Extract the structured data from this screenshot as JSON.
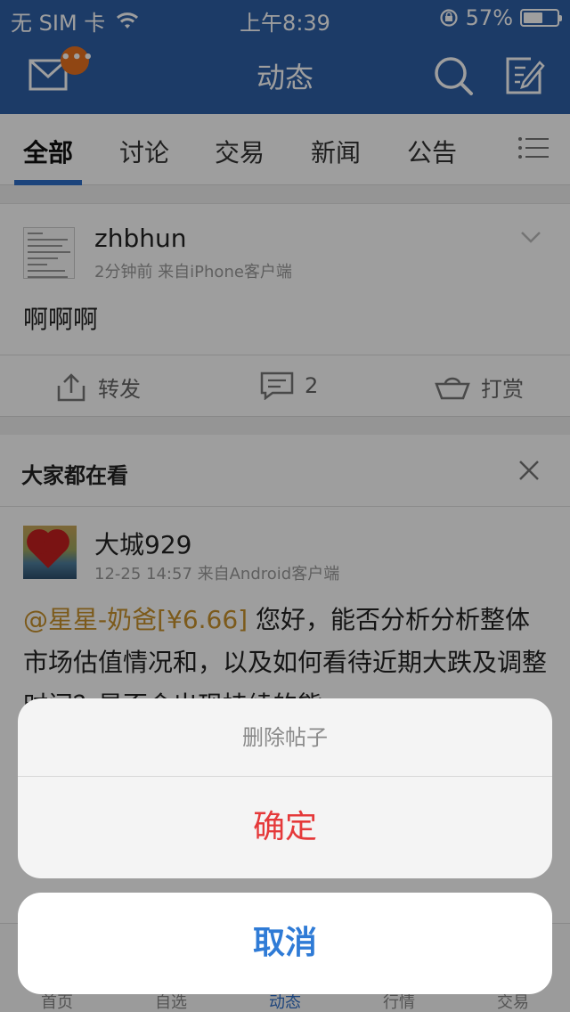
{
  "status_bar": {
    "carrier": "无 SIM 卡",
    "time": "上午8:39",
    "battery": "57%",
    "battery_level": 0.57
  },
  "navbar": {
    "title": "动态",
    "badge": "•••"
  },
  "tabs": [
    {
      "label": "全部",
      "active": true
    },
    {
      "label": "讨论"
    },
    {
      "label": "交易"
    },
    {
      "label": "新闻"
    },
    {
      "label": "公告"
    }
  ],
  "post": {
    "username": "zhbhun",
    "meta": "2分钟前  来自iPhone客户端",
    "content": "啊啊啊",
    "actions": {
      "forward": "转发",
      "comment_count": "2",
      "tip": "打赏"
    }
  },
  "recommend": {
    "heading": "大家都在看",
    "username": "大城929",
    "meta": "12-25 14:57  来自Android客户端",
    "mention": "@星星-奶爸[¥6.66]",
    "text": " 您好，能否分析分析整体市场估值情况和，以及如何看待近期大跌及调整时间？是否会出现持续的熊"
  },
  "tabbar": [
    {
      "label": "首页"
    },
    {
      "label": "自选"
    },
    {
      "label": "动态",
      "active": true
    },
    {
      "label": "行情"
    },
    {
      "label": "交易"
    }
  ],
  "action_sheet": {
    "title": "删除帖子",
    "confirm": "确定",
    "cancel": "取消"
  },
  "colors": {
    "brand_blue": "#2e5fa6",
    "accent_blue": "#2f7bd6",
    "danger_red": "#e5393a",
    "badge_orange": "#e8711f",
    "mention_gold": "#c8922c"
  }
}
